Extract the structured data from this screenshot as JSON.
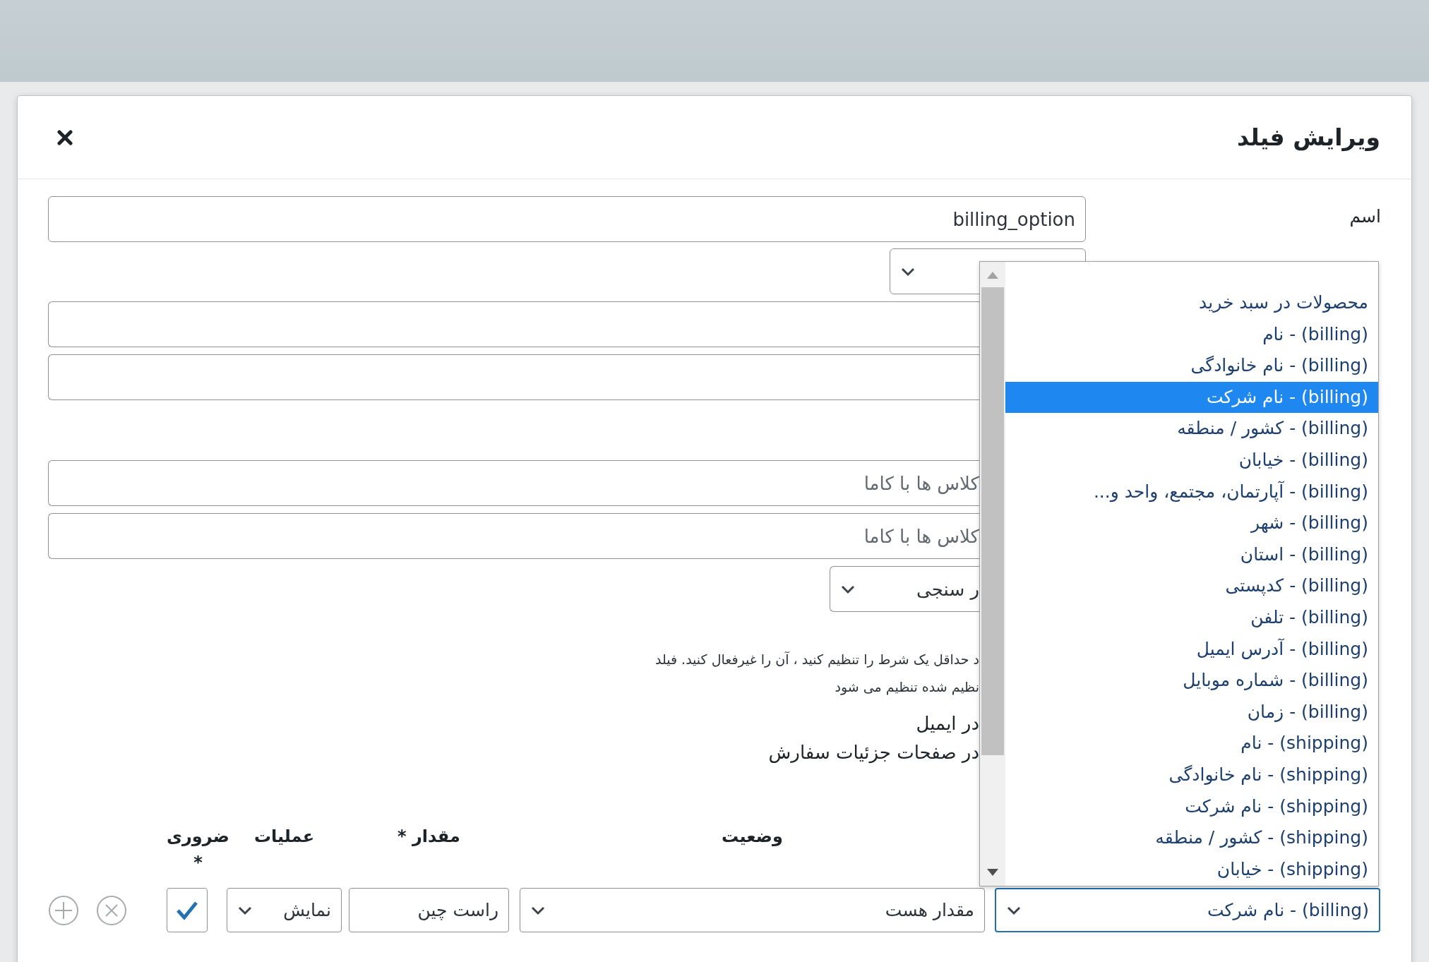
{
  "dialog": {
    "title": "ویرایش فیلد"
  },
  "fields": [
    {
      "kind": "text",
      "label": "اسم",
      "value": "billing_option"
    },
    {
      "kind": "select"
    },
    {
      "kind": "text"
    },
    {
      "kind": "text"
    },
    {
      "kind": "blank"
    },
    {
      "kind": "text",
      "placeholder": "کلاس ها با کاما"
    },
    {
      "kind": "text",
      "placeholder": "کلاس ها با کاما"
    },
    {
      "kind": "select",
      "value": "ر سنجی"
    }
  ],
  "notes": [
    "د حداقل یک شرط را تنظیم کنید ، آن را غیرفعال کنید. فیلد",
    "نظیم شده تنظیم می شود"
  ],
  "display_options": [
    "در ایمیل",
    "در صفحات جزئیات سفارش"
  ],
  "conditions": {
    "columns": [
      "وضعیت",
      "مقدار *",
      "عملیات",
      "ضروری *"
    ],
    "rows": [
      {
        "field": "(billing) - نام شرکت",
        "state": "مقدار هست",
        "value": "راست چین",
        "operation": "نمایش",
        "required": true
      }
    ]
  },
  "dropdown": {
    "options": [
      {
        "label": "محصولات در سبد خرید",
        "selected": false
      },
      {
        "label": "(billing) - نام",
        "selected": false
      },
      {
        "label": "(billing) - نام خانوادگی",
        "selected": false
      },
      {
        "label": "(billing) - نام شرکت",
        "selected": true
      },
      {
        "label": "(billing) - کشور / منطقه",
        "selected": false
      },
      {
        "label": "(billing) - خیابان",
        "selected": false
      },
      {
        "label": "(billing) - آپارتمان، مجتمع، واحد و...",
        "selected": false
      },
      {
        "label": "(billing) - شهر",
        "selected": false
      },
      {
        "label": "(billing) - استان",
        "selected": false
      },
      {
        "label": "(billing) - کدپستی",
        "selected": false
      },
      {
        "label": "(billing) - تلفن",
        "selected": false
      },
      {
        "label": "(billing) - آدرس ایمیل",
        "selected": false
      },
      {
        "label": "(billing) - شماره موبایل",
        "selected": false
      },
      {
        "label": "(billing) - زمان",
        "selected": false
      },
      {
        "label": "(shipping) - نام",
        "selected": false
      },
      {
        "label": "(shipping) - نام خانوادگی",
        "selected": false
      },
      {
        "label": "(shipping) - نام شرکت",
        "selected": false
      },
      {
        "label": "(shipping) - کشور / منطقه",
        "selected": false
      },
      {
        "label": "(shipping) - خیابان",
        "selected": false
      }
    ]
  }
}
